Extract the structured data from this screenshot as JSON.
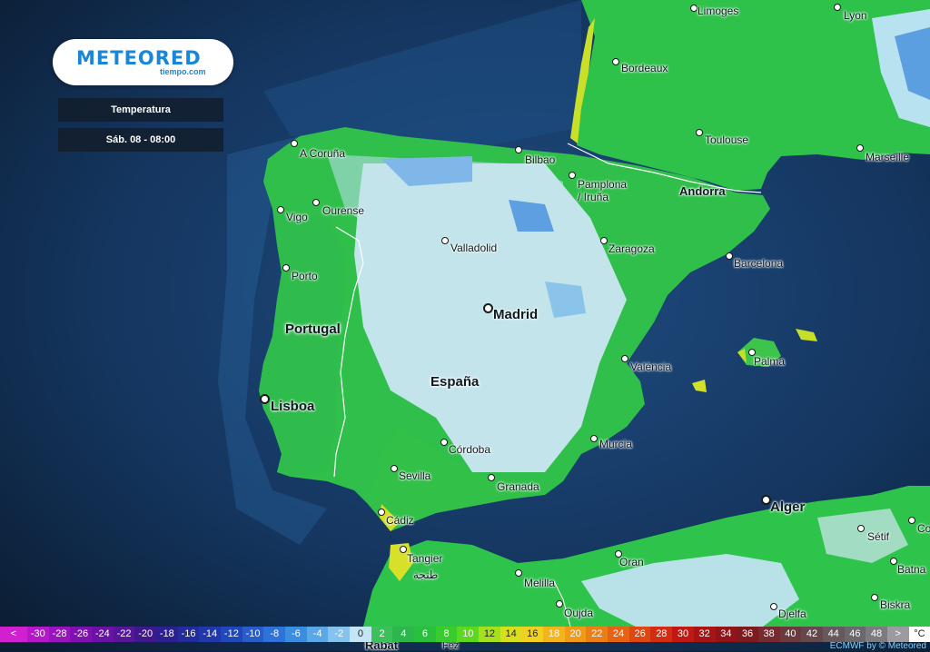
{
  "brand": {
    "name": "METEORED",
    "site": "tiempo.com"
  },
  "panel": {
    "variable": "Temperatura",
    "datetime": "Sáb. 08 - 08:00"
  },
  "cities": [
    {
      "id": "limoges",
      "name": "Limoges"
    },
    {
      "id": "lyon",
      "name": "Lyon"
    },
    {
      "id": "bordeaux",
      "name": "Bordeaux"
    },
    {
      "id": "toulouse",
      "name": "Toulouse"
    },
    {
      "id": "marseille",
      "name": "Marseille"
    },
    {
      "id": "acoruna",
      "name": "A Coruña"
    },
    {
      "id": "bilbao",
      "name": "Bilbao"
    },
    {
      "id": "pamplona",
      "name": "Pamplona\n/ Iruña"
    },
    {
      "id": "andorra",
      "name": "Andorra"
    },
    {
      "id": "ourense",
      "name": "Ourense"
    },
    {
      "id": "vigo",
      "name": "Vigo"
    },
    {
      "id": "valladolid",
      "name": "Valladolid"
    },
    {
      "id": "zaragoza",
      "name": "Zaragoza"
    },
    {
      "id": "barcelona",
      "name": "Barcelona"
    },
    {
      "id": "porto",
      "name": "Porto"
    },
    {
      "id": "madrid",
      "name": "Madrid"
    },
    {
      "id": "palma",
      "name": "Palma"
    },
    {
      "id": "valencia",
      "name": "València"
    },
    {
      "id": "lisboa",
      "name": "Lisboa"
    },
    {
      "id": "murcia",
      "name": "Murcia"
    },
    {
      "id": "cordoba",
      "name": "Córdoba"
    },
    {
      "id": "sevilla",
      "name": "Sevilla"
    },
    {
      "id": "granada",
      "name": "Granada"
    },
    {
      "id": "cadiz",
      "name": "Cádiz"
    },
    {
      "id": "alger",
      "name": "Alger"
    },
    {
      "id": "setif",
      "name": "Sétif"
    },
    {
      "id": "co",
      "name": "Co"
    },
    {
      "id": "tangier",
      "name": "Tangier"
    },
    {
      "id": "tangier_ar",
      "name": "طنجة"
    },
    {
      "id": "oran",
      "name": "Oran"
    },
    {
      "id": "melilla",
      "name": "Melilla"
    },
    {
      "id": "batna",
      "name": "Batna"
    },
    {
      "id": "oujda",
      "name": "Oujda"
    },
    {
      "id": "djelfa",
      "name": "Djelfa"
    },
    {
      "id": "biskra",
      "name": "Biskra"
    },
    {
      "id": "rabat",
      "name": "Rabat"
    },
    {
      "id": "fez",
      "name": "Fez"
    }
  ],
  "countries": {
    "portugal": "Portugal",
    "espana": "España"
  },
  "legend": [
    {
      "label": "<",
      "color": "#d020d0"
    },
    {
      "label": "-30",
      "color": "#b418c8"
    },
    {
      "label": "-28",
      "color": "#9a14bd"
    },
    {
      "label": "-26",
      "color": "#8010b0"
    },
    {
      "label": "-24",
      "color": "#6a12a4"
    },
    {
      "label": "-22",
      "color": "#561698"
    },
    {
      "label": "-20",
      "color": "#40188e"
    },
    {
      "label": "-18",
      "color": "#2c2090"
    },
    {
      "label": "-16",
      "color": "#222c9a"
    },
    {
      "label": "-14",
      "color": "#2038aa"
    },
    {
      "label": "-12",
      "color": "#2048ba"
    },
    {
      "label": "-10",
      "color": "#2a5cc8"
    },
    {
      "label": "-8",
      "color": "#2e74d8"
    },
    {
      "label": "-6",
      "color": "#3a8ee0"
    },
    {
      "label": "-4",
      "color": "#5aa8e8"
    },
    {
      "label": "-2",
      "color": "#86c2ee"
    },
    {
      "label": "0",
      "color": "#c4e6f4"
    },
    {
      "label": "2",
      "color": "#3cc05a"
    },
    {
      "label": "4",
      "color": "#2cb64c"
    },
    {
      "label": "6",
      "color": "#28c03c"
    },
    {
      "label": "8",
      "color": "#38cc2c"
    },
    {
      "label": "10",
      "color": "#5cd81e"
    },
    {
      "label": "12",
      "color": "#a4e01c"
    },
    {
      "label": "14",
      "color": "#d8e01e"
    },
    {
      "label": "16",
      "color": "#f0d020"
    },
    {
      "label": "18",
      "color": "#f4b41c"
    },
    {
      "label": "20",
      "color": "#f09a18"
    },
    {
      "label": "22",
      "color": "#ec7e16"
    },
    {
      "label": "24",
      "color": "#e66214"
    },
    {
      "label": "26",
      "color": "#de4612"
    },
    {
      "label": "28",
      "color": "#d22c12"
    },
    {
      "label": "30",
      "color": "#c01812"
    },
    {
      "label": "32",
      "color": "#a81414"
    },
    {
      "label": "34",
      "color": "#921418"
    },
    {
      "label": "36",
      "color": "#7e1a1e"
    },
    {
      "label": "38",
      "color": "#742a2e"
    },
    {
      "label": "40",
      "color": "#6a3a3e"
    },
    {
      "label": "42",
      "color": "#66484c"
    },
    {
      "label": "44",
      "color": "#66585c"
    },
    {
      "label": "46",
      "color": "#6a686c"
    },
    {
      "label": "48",
      "color": "#7c7c80"
    },
    {
      "label": ">",
      "color": "#9c9ca0"
    },
    {
      "label": "°C",
      "color": "#ffffff"
    }
  ],
  "credit": "ECMWF by © Meteored"
}
